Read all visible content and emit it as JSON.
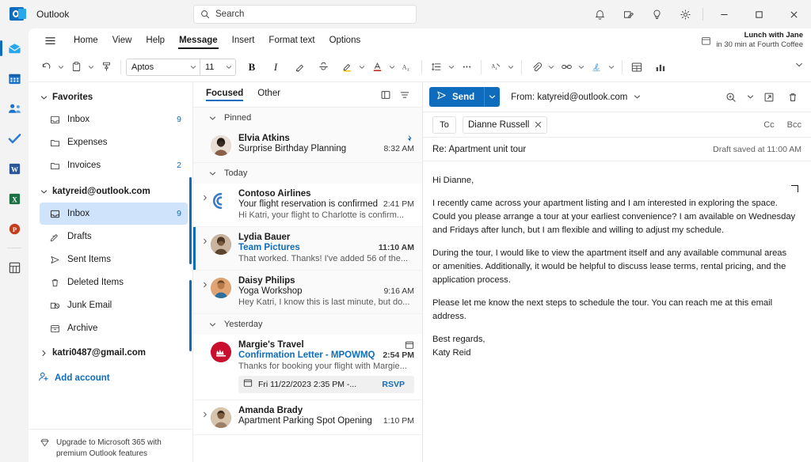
{
  "titlebar": {
    "app_name": "Outlook",
    "search_placeholder": "Search",
    "icons": [
      "bell-icon",
      "note-icon",
      "lightbulb-icon",
      "gear-icon"
    ],
    "window_controls": [
      "minimize",
      "maximize",
      "close"
    ]
  },
  "rail": {
    "items": [
      {
        "name": "mail-app",
        "label": "Mail"
      },
      {
        "name": "calendar-app",
        "label": "Calendar"
      },
      {
        "name": "people-app",
        "label": "People"
      },
      {
        "name": "todo-app",
        "label": "To Do"
      },
      {
        "name": "word-app",
        "label": "Word"
      },
      {
        "name": "excel-app",
        "label": "Excel"
      },
      {
        "name": "powerpoint-app",
        "label": "PowerPoint"
      },
      {
        "name": "more-apps",
        "label": "More apps"
      }
    ]
  },
  "ribbon": {
    "tabs": [
      {
        "label": "Home",
        "active": false
      },
      {
        "label": "View",
        "active": false
      },
      {
        "label": "Help",
        "active": false
      },
      {
        "label": "Message",
        "active": true
      },
      {
        "label": "Insert",
        "active": false
      },
      {
        "label": "Format text",
        "active": false
      },
      {
        "label": "Options",
        "active": false
      }
    ],
    "appointment": {
      "title": "Lunch with Jane",
      "detail": "in 30 min at Fourth Coffee"
    },
    "font_name": "Aptos",
    "font_size": "11",
    "bold_label": "B",
    "italic_label": "I",
    "tools": [
      "undo-icon",
      "paste-icon",
      "format-painter-icon",
      "bold-icon",
      "italic-icon",
      "highlighter-icon",
      "strikethrough-icon",
      "font-color-icon",
      "text-highlight-icon",
      "clear-formatting-icon",
      "list-icon",
      "more-options-icon",
      "dictate-icon",
      "attach-icon",
      "link-icon",
      "signature-icon",
      "table-icon",
      "poll-icon"
    ]
  },
  "folders": {
    "groups": [
      {
        "name": "Favorites",
        "label": "Favorites",
        "expanded": true,
        "items": [
          {
            "label": "Inbox",
            "count": "9",
            "icon": "inbox-icon",
            "selected": false
          },
          {
            "label": "Expenses",
            "count": "",
            "icon": "folder-icon",
            "selected": false
          },
          {
            "label": "Invoices",
            "count": "2",
            "icon": "folder-icon",
            "selected": false
          }
        ]
      },
      {
        "name": "katyreid@outlook.com",
        "label": "katyreid@outlook.com",
        "expanded": true,
        "items": [
          {
            "label": "Inbox",
            "count": "9",
            "icon": "inbox-icon",
            "selected": true
          },
          {
            "label": "Drafts",
            "count": "",
            "icon": "drafts-icon",
            "selected": false
          },
          {
            "label": "Sent Items",
            "count": "",
            "icon": "sent-icon",
            "selected": false
          },
          {
            "label": "Deleted Items",
            "count": "",
            "icon": "trash-icon",
            "selected": false
          },
          {
            "label": "Junk Email",
            "count": "",
            "icon": "junk-icon",
            "selected": false
          },
          {
            "label": "Archive",
            "count": "",
            "icon": "archive-icon",
            "selected": false
          }
        ]
      }
    ],
    "second_account": "katri0487@gmail.com",
    "add_account": "Add account",
    "upgrade": "Upgrade to Microsoft 365 with premium Outlook features"
  },
  "message_list": {
    "tabs": [
      {
        "label": "Focused",
        "active": true
      },
      {
        "label": "Other",
        "active": false
      }
    ],
    "header_icons": [
      "reading-pane-icon",
      "filter-icon"
    ],
    "groups": [
      {
        "label": "Pinned",
        "messages": [
          {
            "sender": "Elvia Atkins",
            "subject": "Surprise Birthday Planning",
            "preview": "",
            "time": "8:32 AM",
            "pinned": true,
            "selected": false,
            "avatar_color": "#c9b8a8",
            "avatar_type": "photo",
            "subject_link": false,
            "expandable": false
          }
        ]
      },
      {
        "label": "Today",
        "messages": [
          {
            "sender": "Contoso Airlines",
            "subject": "Your flight reservation is confirmed",
            "preview": "Hi Katri, your flight to Charlotte is confirm...",
            "time": "2:41 PM",
            "pinned": false,
            "selected": false,
            "avatar_color": "#ffffff",
            "avatar_type": "contoso",
            "subject_link": false,
            "expandable": true
          },
          {
            "sender": "Lydia Bauer",
            "subject": "Team Pictures",
            "preview": "That worked. Thanks! I've added 56 of the...",
            "time": "11:10 AM",
            "pinned": false,
            "selected": true,
            "avatar_color": "#8a6f5c",
            "avatar_type": "photo",
            "subject_link": true,
            "expandable": true
          },
          {
            "sender": "Daisy Philips",
            "subject": "Yoga Workshop",
            "preview": "Hey Katri, I know this is last minute, but do...",
            "time": "9:16 AM",
            "pinned": false,
            "selected": false,
            "avatar_color": "#d9a06a",
            "avatar_type": "photo",
            "subject_link": false,
            "expandable": true
          }
        ]
      },
      {
        "label": "Yesterday",
        "messages": [
          {
            "sender": "Margie's Travel",
            "subject": "Confirmation Letter - MPOWMQ",
            "preview": "Thanks for booking your flight with Margie...",
            "time": "2:54 PM",
            "pinned": false,
            "selected": false,
            "avatar_color": "#c8102e",
            "avatar_type": "margies",
            "subject_link": true,
            "expandable": false,
            "calendar_chip": {
              "text": "Fri 11/22/2023 2:35 PM -...",
              "action": "RSVP"
            },
            "has_calendar_flag": true
          },
          {
            "sender": "Amanda Brady",
            "subject": "Apartment Parking Spot Opening",
            "preview": "",
            "time": "1:10 PM",
            "pinned": false,
            "selected": false,
            "avatar_color": "#b08968",
            "avatar_type": "photo",
            "subject_link": false,
            "expandable": true
          }
        ]
      }
    ]
  },
  "compose": {
    "send_label": "Send",
    "from_label": "From: katyreid@outlook.com",
    "to_label": "To",
    "recipient": "Dianne Russell",
    "cc_label": "Cc",
    "bcc_label": "Bcc",
    "subject": "Re: Apartment unit tour",
    "draft_status": "Draft saved at 11:00 AM",
    "command_icons": [
      "zoom-icon",
      "popout-icon",
      "discard-icon"
    ],
    "body_paragraphs": [
      "Hi Dianne,",
      "I recently came across your apartment listing and I am interested in exploring the space. Could you please arrange a tour at your earliest convenience? I am available on Wednesday and Fridays after lunch, but I am flexible and willing to adjust my schedule.",
      "During the tour, I would like to view the apartment itself and any available communal areas or amenities. Additionally, it would be helpful to discuss lease terms, rental pricing, and the application process.",
      "Please let me know the next steps to schedule the tour. You can reach me at this email address."
    ],
    "signature_line1": "Best regards,",
    "signature_line2": "Katy Reid"
  },
  "colors": {
    "accent": "#0f6cbd",
    "selection": "#cfe4fa",
    "surface": "#ffffff",
    "chrome": "#f3f3f3"
  }
}
